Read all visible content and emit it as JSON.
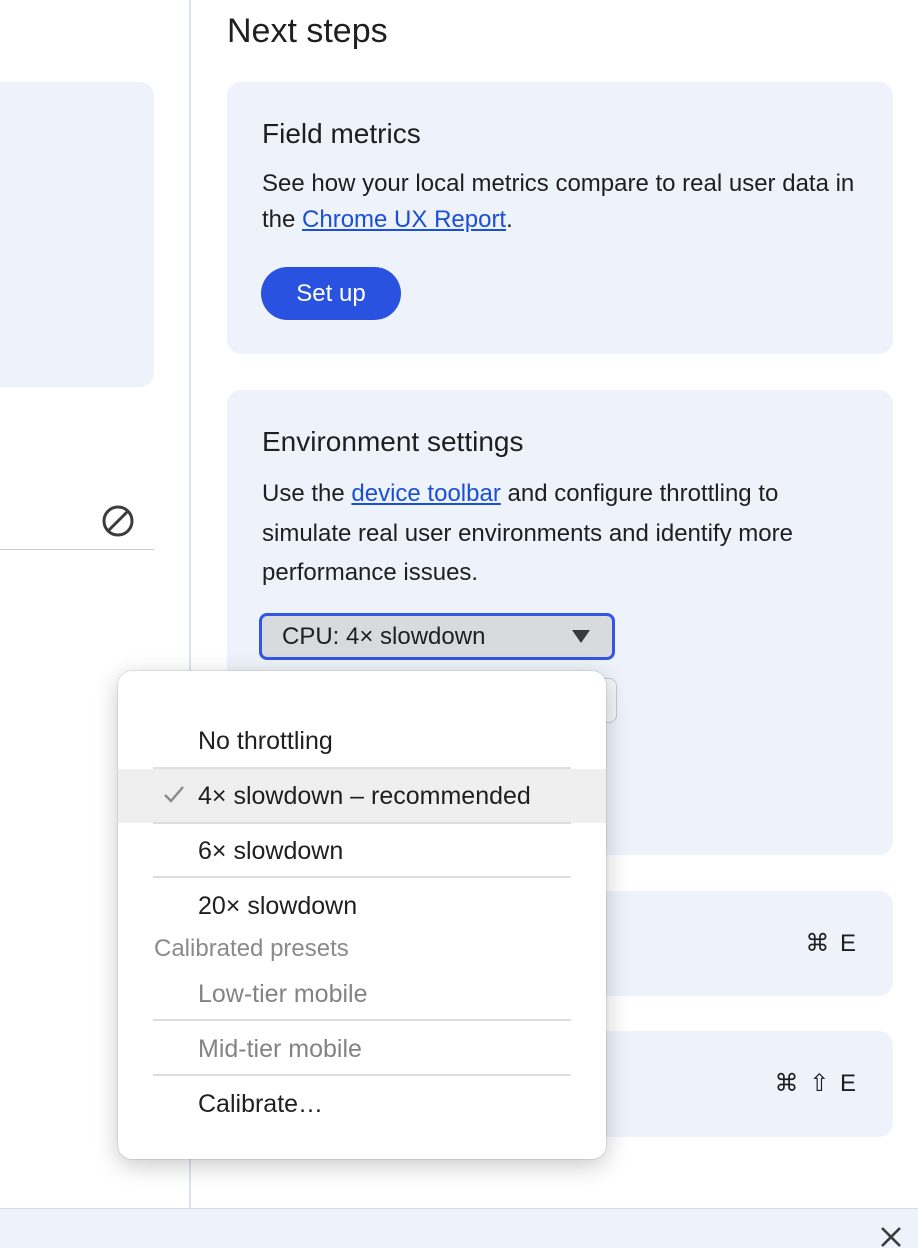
{
  "header": {
    "title": "Next steps"
  },
  "field_metrics": {
    "title": "Field metrics",
    "text_before": "See how your local metrics compare to real user data in the ",
    "link": "Chrome UX Report",
    "text_after": ".",
    "button": "Set up"
  },
  "environment": {
    "title": "Environment settings",
    "text_before": "Use the ",
    "link": "device toolbar",
    "text_after": " and configure throttling to simulate real user environments and identify more performance issues.",
    "cpu_select": {
      "value": "CPU: 4× slowdown"
    }
  },
  "shortcuts": {
    "record": "⌘ E",
    "record_reload": "⌘ ⇧ E"
  },
  "cpu_menu": {
    "items": [
      {
        "label": "No throttling",
        "checked": false,
        "disabled": false
      },
      {
        "label": "4× slowdown – recommended",
        "checked": true,
        "disabled": false
      },
      {
        "label": "6× slowdown",
        "checked": false,
        "disabled": false
      },
      {
        "label": "20× slowdown",
        "checked": false,
        "disabled": false
      }
    ],
    "group_label": "Calibrated presets",
    "presets": [
      {
        "label": "Low-tier mobile",
        "disabled": true
      },
      {
        "label": "Mid-tier mobile",
        "disabled": true
      }
    ],
    "calibrate": "Calibrate…"
  },
  "icons": {
    "clear": "block-icon",
    "check": "checkmark-icon",
    "close": "close-icon",
    "dropdown": "triangle-down-icon"
  },
  "colors": {
    "accent": "#2a52e0",
    "link": "#1a4fd6",
    "card_bg": "#eef2fa"
  }
}
